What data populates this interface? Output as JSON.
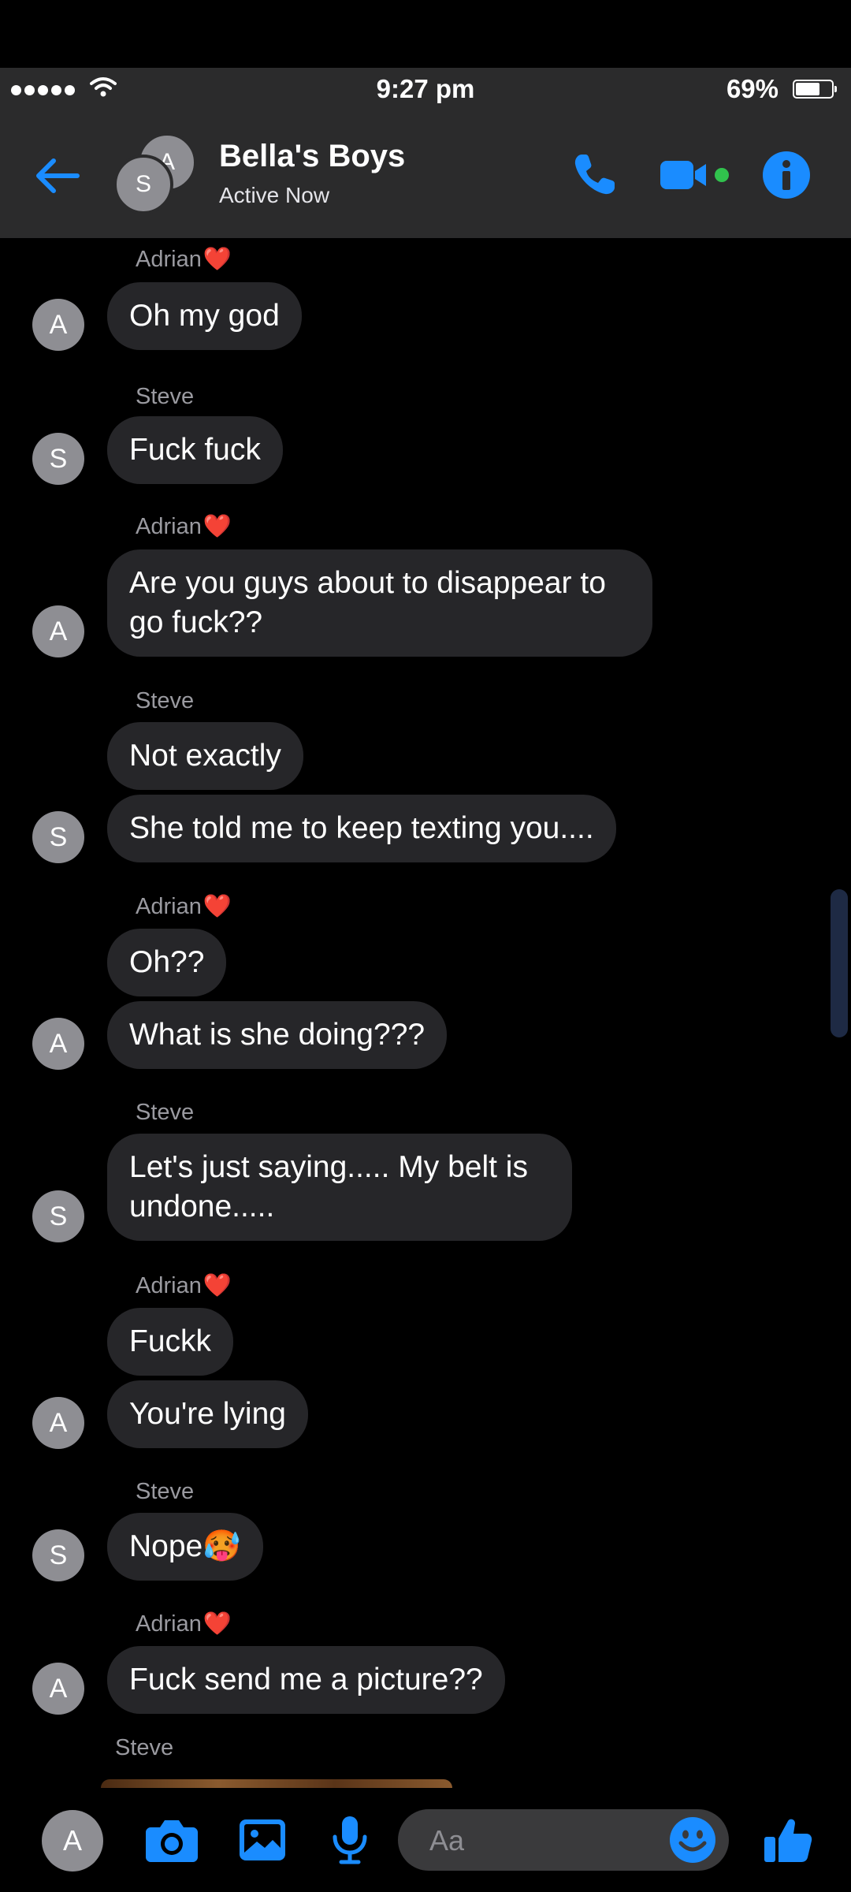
{
  "status_bar": {
    "time": "9:27 pm",
    "battery": "69%",
    "battery_level": 0.69
  },
  "header": {
    "title": "Bella's Boys",
    "status": "Active Now",
    "avatar_back": "A",
    "avatar_front": "S"
  },
  "messages": [
    {
      "sender": "Adrian",
      "heart": "❤️",
      "avatar": "A",
      "bubbles": [
        "Oh my god"
      ]
    },
    {
      "sender": "Steve",
      "heart": "",
      "avatar": "S",
      "bubbles": [
        "Fuck fuck"
      ]
    },
    {
      "sender": "Adrian",
      "heart": "❤️",
      "avatar": "A",
      "bubbles": [
        "Are you guys about to disappear to go fuck??"
      ]
    },
    {
      "sender": "Steve",
      "heart": "",
      "avatar": "S",
      "bubbles": [
        "Not exactly",
        "She told me to keep texting you...."
      ]
    },
    {
      "sender": "Adrian",
      "heart": "❤️",
      "avatar": "A",
      "bubbles": [
        "Oh??",
        "What is she doing???"
      ]
    },
    {
      "sender": "Steve",
      "heart": "",
      "avatar": "S",
      "bubbles": [
        "Let's just saying..... My belt is undone....."
      ]
    },
    {
      "sender": "Adrian",
      "heart": "❤️",
      "avatar": "A",
      "bubbles": [
        "Fuckk",
        "You're lying"
      ]
    },
    {
      "sender": "Steve",
      "heart": "",
      "avatar": "S",
      "bubbles": [
        "Nope🥵"
      ]
    },
    {
      "sender": "Adrian",
      "heart": "❤️",
      "avatar": "A",
      "bubbles": [
        "Fuck send me a picture??"
      ]
    },
    {
      "sender": "Steve",
      "heart": "",
      "avatar": "",
      "bubbles": []
    }
  ],
  "composer": {
    "avatar": "A",
    "placeholder": "Aa"
  },
  "colors": {
    "accent": "#1a8cff",
    "online": "#31c24d",
    "bubble": "#262629",
    "header": "#2b2b2c"
  }
}
